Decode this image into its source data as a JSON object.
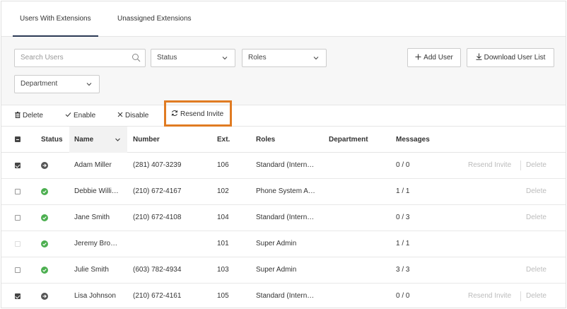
{
  "tabs": [
    {
      "label": "Users With Extensions",
      "active": true
    },
    {
      "label": "Unassigned Extensions",
      "active": false
    }
  ],
  "filters": {
    "search_placeholder": "Search Users",
    "status": "Status",
    "roles": "Roles",
    "department": "Department",
    "add_user": "Add User",
    "download_list": "Download User List"
  },
  "actions": {
    "delete": "Delete",
    "enable": "Enable",
    "disable": "Disable",
    "resend_invite": "Resend Invite"
  },
  "columns": {
    "status": "Status",
    "name": "Name",
    "number": "Number",
    "ext": "Ext.",
    "roles": "Roles",
    "department": "Department",
    "messages": "Messages"
  },
  "row_actions": {
    "resend": "Resend Invite",
    "delete": "Delete"
  },
  "rows": [
    {
      "checked": true,
      "disabled": false,
      "status": "pending",
      "name": "Adam Miller",
      "number": "(281) 407-3239",
      "ext": "106",
      "role": "Standard (Intern…",
      "messages": "0 / 0",
      "show_resend": true,
      "show_delete": true
    },
    {
      "checked": false,
      "disabled": false,
      "status": "active",
      "name": "Debbie Willi…",
      "number": "(210) 672-4167",
      "ext": "102",
      "role": "Phone System A…",
      "messages": "1 / 1",
      "show_resend": false,
      "show_delete": true
    },
    {
      "checked": false,
      "disabled": false,
      "status": "active",
      "name": "Jane Smith",
      "number": "(210) 672-4108",
      "ext": "104",
      "role": "Standard (Intern…",
      "messages": "0 / 3",
      "show_resend": false,
      "show_delete": true
    },
    {
      "checked": false,
      "disabled": true,
      "status": "active",
      "name": "Jeremy Bro…",
      "number": "",
      "ext": "101",
      "role": "Super Admin",
      "messages": "1 / 1",
      "show_resend": false,
      "show_delete": false
    },
    {
      "checked": false,
      "disabled": false,
      "status": "active",
      "name": "Julie Smith",
      "number": "(603) 782-4934",
      "ext": "103",
      "role": "Super Admin",
      "messages": "3 / 3",
      "show_resend": false,
      "show_delete": true
    },
    {
      "checked": true,
      "disabled": false,
      "status": "pending",
      "name": "Lisa Johnson",
      "number": "(210) 672-4161",
      "ext": "105",
      "role": "Standard (Intern…",
      "messages": "0 / 0",
      "show_resend": true,
      "show_delete": true
    }
  ],
  "colors": {
    "highlight": "#e07b22",
    "active_status": "#4caf50",
    "pending_status": "#555555"
  }
}
